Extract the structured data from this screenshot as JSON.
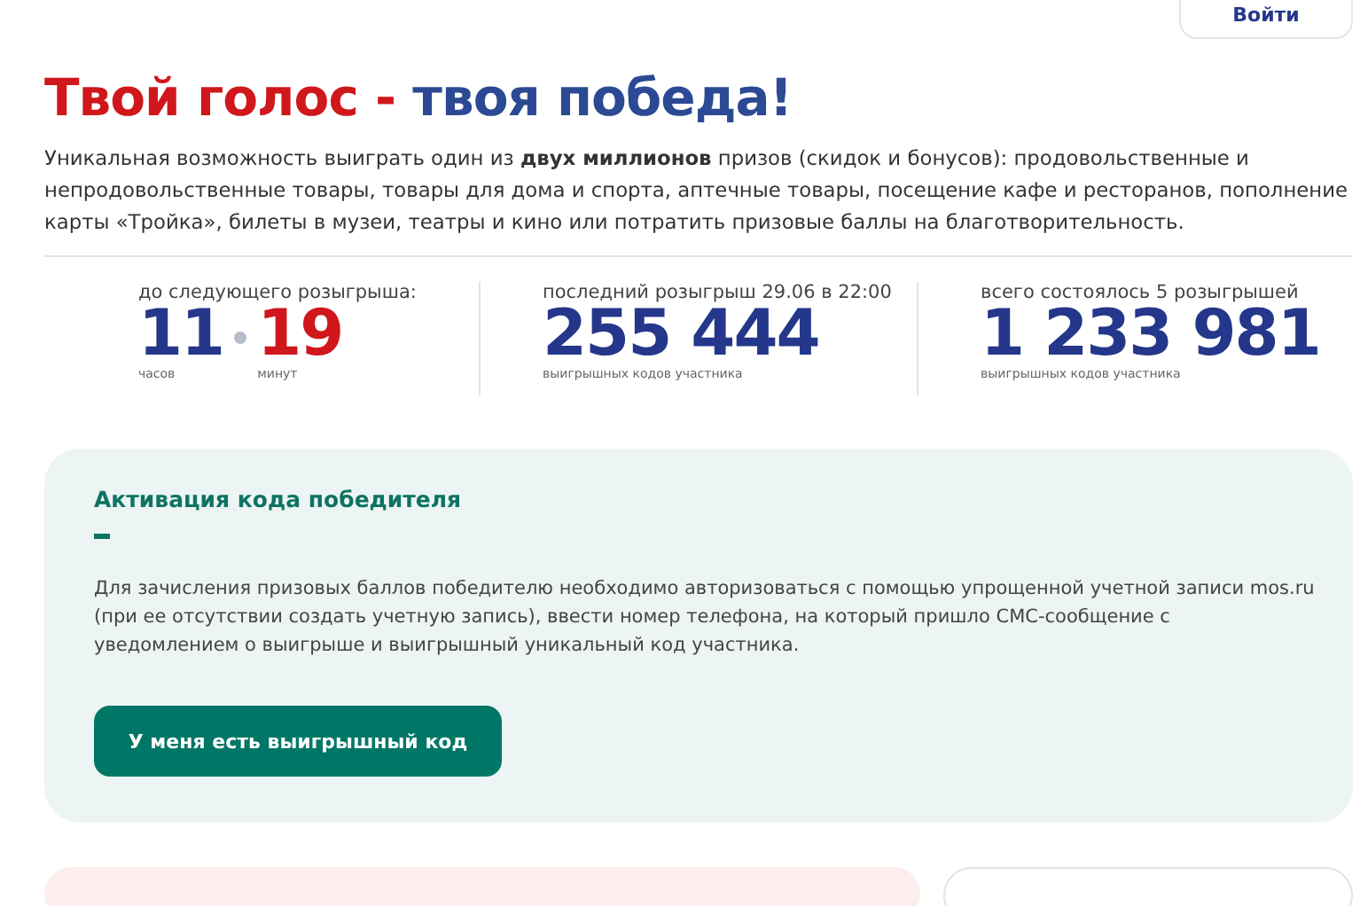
{
  "header": {
    "login_button": "Войти"
  },
  "title": {
    "part_1": "Твой голос -",
    "part_2": "твоя победа!"
  },
  "intro": "Уникальная возможность выиграть один из **двух миллионов** призов (скидок и бонусов): продовольственные и непродовольственные товары, товары для дома и спорта, аптечные товары, посещение кафе и ресторанов, пополнение карты «Тройка», билеты в музеи, театры и кино или потратить призовые баллы на благотворительность.",
  "stats": [
    {
      "kind": "countdown",
      "label": "до следующего розыгрыша:",
      "hours": "11",
      "hours_unit": "часов",
      "minutes": "19",
      "minutes_unit": "минут"
    },
    {
      "kind": "number",
      "label": "последний розыгрыш 29.06 в 22:00",
      "value": "255 444",
      "caption": "выигрышных кодов участника"
    },
    {
      "kind": "number",
      "label": "всего состоялось 5 розыгрышей",
      "value": "1 233 981",
      "caption": "выигрышных кодов участника"
    }
  ],
  "activation": {
    "title": "Активация кода победителя",
    "text": "Для зачисления призовых баллов победителю необходимо авторизоваться с помощью упрощенной учетной записи mos.ru (при ее отсутствии создать учетную запись), ввести номер телефона, на который пришло СМС-сообщение с уведомлением о выигрыше и выигрышный уникальный код участника.",
    "button": "У меня есть выигрышный код"
  }
}
